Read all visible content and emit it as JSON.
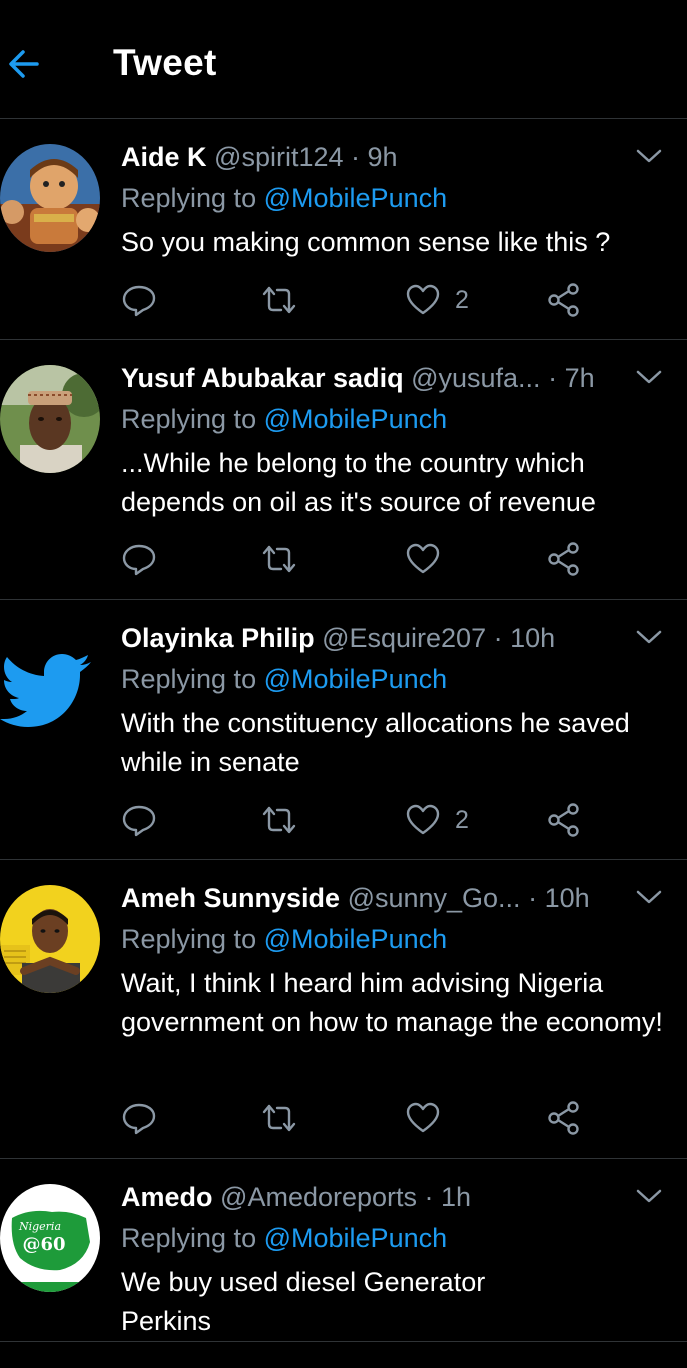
{
  "header": {
    "title": "Tweet"
  },
  "colors": {
    "accent": "#1d9bf0",
    "muted": "#8b98a5",
    "divider": "#2f3336"
  },
  "tweets": [
    {
      "name": "Aide K",
      "handle": "@spirit124",
      "time": "· 9h",
      "reply_prefix": "Replying to",
      "reply_to": "@MobilePunch",
      "text": "So you making common sense like this ?",
      "likes": "2",
      "avatar_icon": "cartoon-hero-avatar"
    },
    {
      "name": "Yusuf Abubakar sadiq",
      "handle": "@yusufa...",
      "time": "· 7h",
      "reply_prefix": "Replying to",
      "reply_to": "@MobilePunch",
      "text": "...While he belong to the country which depends on oil as it's source of revenue",
      "likes": "",
      "avatar_icon": "person-photo-avatar"
    },
    {
      "name": "Olayinka Philip",
      "handle": "@Esquire207",
      "time": "· 10h",
      "reply_prefix": "Replying to",
      "reply_to": "@MobilePunch",
      "text": "With the constituency allocations  he saved while in senate",
      "likes": "2",
      "avatar_icon": "twitter-bird-avatar"
    },
    {
      "name": "Ameh Sunnyside",
      "handle": "@sunny_Go...",
      "time": "· 10h",
      "reply_prefix": "Replying to",
      "reply_to": "@MobilePunch",
      "text": "Wait, I think I heard him advising Nigeria government on how to manage the economy!",
      "likes": "",
      "avatar_icon": "person-yellow-avatar"
    },
    {
      "name": "Amedo",
      "handle": "@Amedoreports",
      "time": "· 1h",
      "reply_prefix": "Replying to",
      "reply_to": "@MobilePunch",
      "text": "We buy used diesel Generator Perkins",
      "likes": "",
      "avatar_icon": "nigeria-60-logo-avatar",
      "avatar_logo_line1": "Nigeria",
      "avatar_logo_line2": "@60"
    }
  ]
}
